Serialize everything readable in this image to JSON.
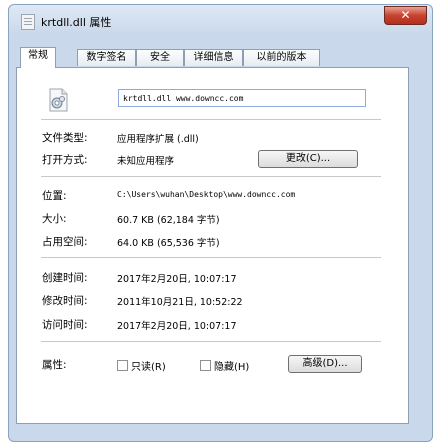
{
  "window": {
    "title": "krtdll.dll 属性",
    "close_label": "✕"
  },
  "tabs": [
    {
      "label": "常规",
      "active": true
    },
    {
      "label": "数字签名",
      "active": false
    },
    {
      "label": "安全",
      "active": false
    },
    {
      "label": "详细信息",
      "active": false
    },
    {
      "label": "以前的版本",
      "active": false
    }
  ],
  "file": {
    "name": "krtdll.dll www.downcc.com",
    "icon": "file-settings-icon"
  },
  "type": {
    "label": "文件类型:",
    "value": "应用程序扩展 (.dll)"
  },
  "opens_with": {
    "label": "打开方式:",
    "value": "未知应用程序",
    "change_button": "更改(C)..."
  },
  "location": {
    "label": "位置:",
    "value": "C:\\Users\\wuhan\\Desktop\\www.downcc.com"
  },
  "size": {
    "label": "大小:",
    "value": "60.7 KB (62,184 字节)"
  },
  "size_on_disk": {
    "label": "占用空间:",
    "value": "64.0 KB (65,536 字节)"
  },
  "created": {
    "label": "创建时间:",
    "value": "2017年2月20日, 10:07:17"
  },
  "modified": {
    "label": "修改时间:",
    "value": "2011年10月21日, 10:52:22"
  },
  "accessed": {
    "label": "访问时间:",
    "value": "2017年2月20日, 10:07:17"
  },
  "attributes": {
    "label": "属性:",
    "readonly_label": "只读(R)",
    "hidden_label": "隐藏(H)",
    "advanced_button": "高级(D)...",
    "readonly_checked": false,
    "hidden_checked": false
  }
}
